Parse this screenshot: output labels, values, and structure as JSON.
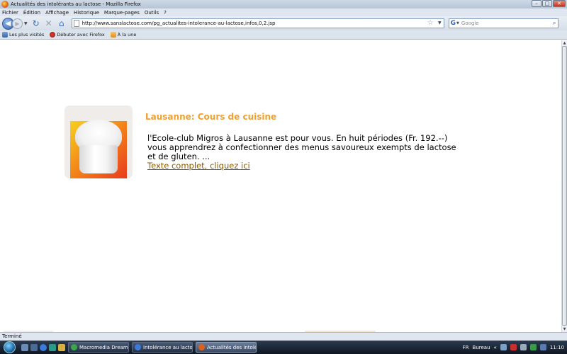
{
  "window": {
    "title": "Actualités des intolérants au lactose - Mozilla Firefox",
    "controls": {
      "minimize": "–",
      "maximize": "□",
      "close": "✕"
    }
  },
  "menu": [
    "Fichier",
    "Édition",
    "Affichage",
    "Historique",
    "Marque-pages",
    "Outils",
    "?"
  ],
  "nav": {
    "url": "http://www.sanslactose.com/pg_actualites-intolerance-au-lactose,infos,0,2.jsp",
    "search_placeholder": "Google",
    "search_engine": "G"
  },
  "bookmarks": [
    "Les plus visités",
    "Débuter avec Firefox",
    "À la une"
  ],
  "article": {
    "title": "Lausanne: Cours de cuisine",
    "body": "l'Ecole-club Migros à Lausanne est pour vous. En huit périodes (Fr. 192.--) vous apprendrez à confectionner des menus savoureux exempts de lactose et de gluten. ...",
    "link": "Texte complet, cliquez ici",
    "title_color": "#f0a030",
    "link_color": "#8a5a00"
  },
  "status": "Terminé",
  "taskbar": {
    "tasks": [
      "Macromedia Dream...",
      "Intolérance au lacto...",
      "Actualités des intolé..."
    ],
    "language": "FR",
    "desktop": "Bureau",
    "time": "11:10"
  }
}
